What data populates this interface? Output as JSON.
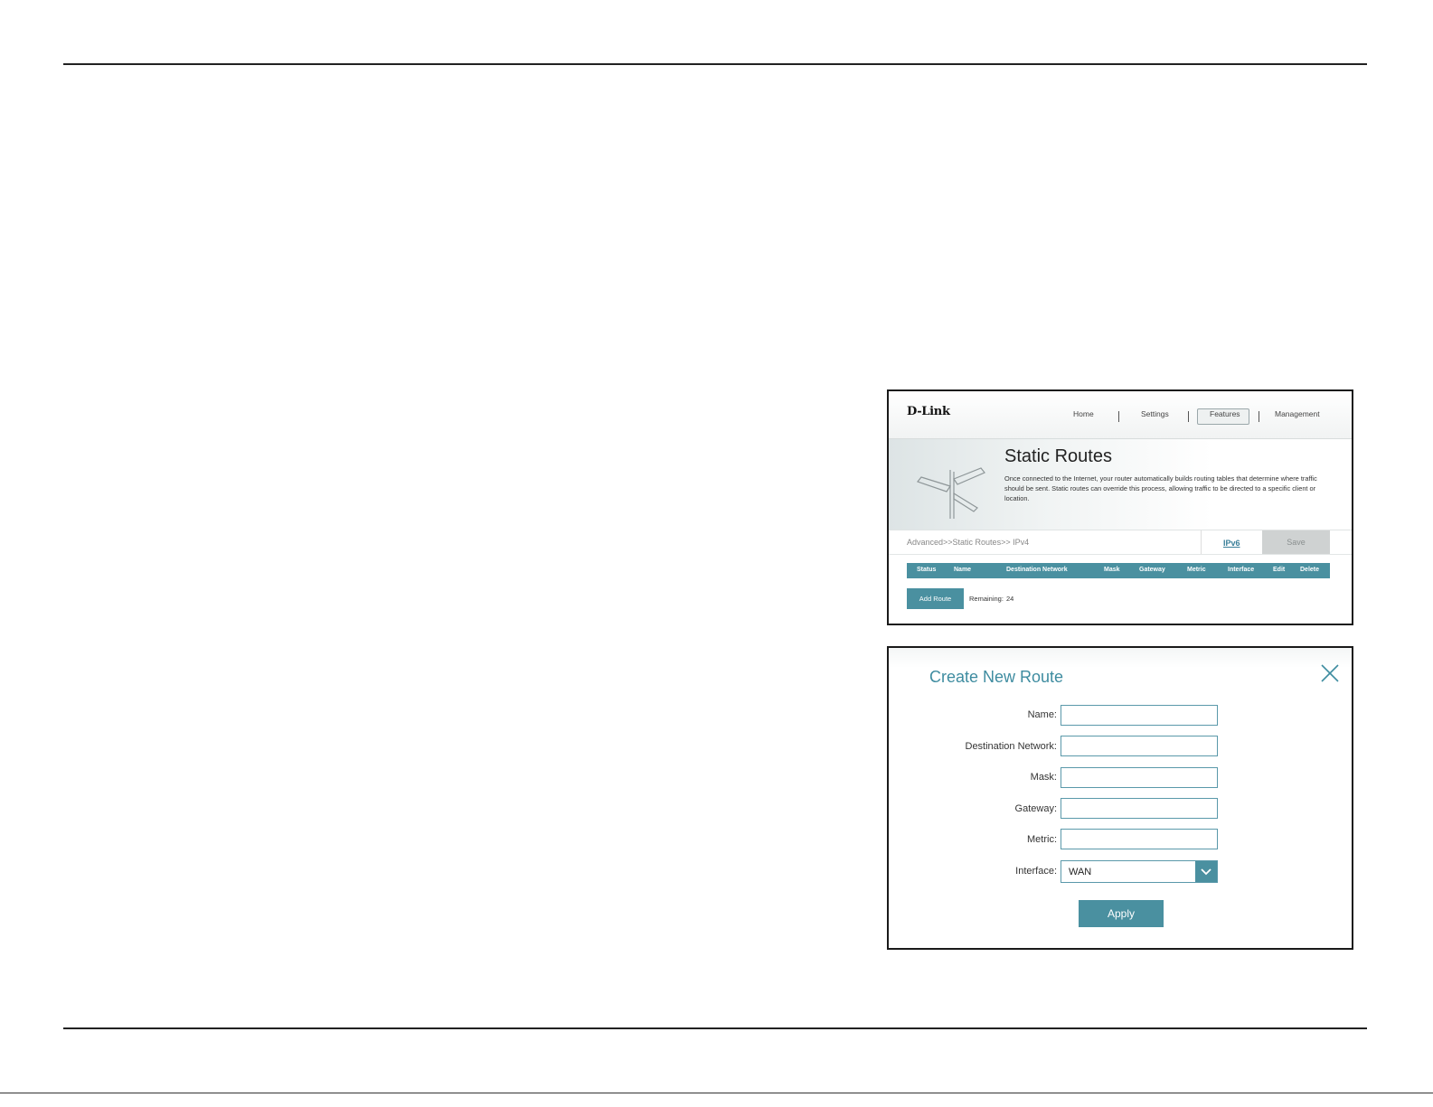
{
  "router": {
    "logo": "D-Link",
    "nav": [
      {
        "label": "Home"
      },
      {
        "label": "Settings"
      },
      {
        "label": "Features",
        "active": true
      },
      {
        "label": "Management"
      }
    ],
    "page_title": "Static Routes",
    "description": "Once connected to the Internet, your router automatically builds routing tables that determine where traffic should be sent. Static routes can override this process, allowing traffic to be directed to a specific client or location.",
    "breadcrumb": "Advanced>>Static Routes>> IPv4",
    "ipv6_link": "IPv6",
    "save_label": "Save",
    "table_columns": [
      "Status",
      "Name",
      "Destination Network",
      "Mask",
      "Gateway",
      "Metric",
      "Interface",
      "Edit",
      "Delete"
    ],
    "add_route_label": "Add Route",
    "remaining_label": "Remaining:",
    "remaining_count": "24"
  },
  "dialog": {
    "title": "Create New Route",
    "fields": {
      "name": {
        "label": "Name:",
        "value": ""
      },
      "destination": {
        "label": "Destination Network:",
        "value": ""
      },
      "mask": {
        "label": "Mask:",
        "value": ""
      },
      "gateway": {
        "label": "Gateway:",
        "value": ""
      },
      "metric": {
        "label": "Metric:",
        "value": ""
      },
      "interface": {
        "label": "Interface:",
        "value": "WAN"
      }
    },
    "apply_label": "Apply"
  },
  "colors": {
    "accent": "#4a90a0",
    "title_blue": "#3e8ca0",
    "save_disabled": "#cfd2d2"
  }
}
